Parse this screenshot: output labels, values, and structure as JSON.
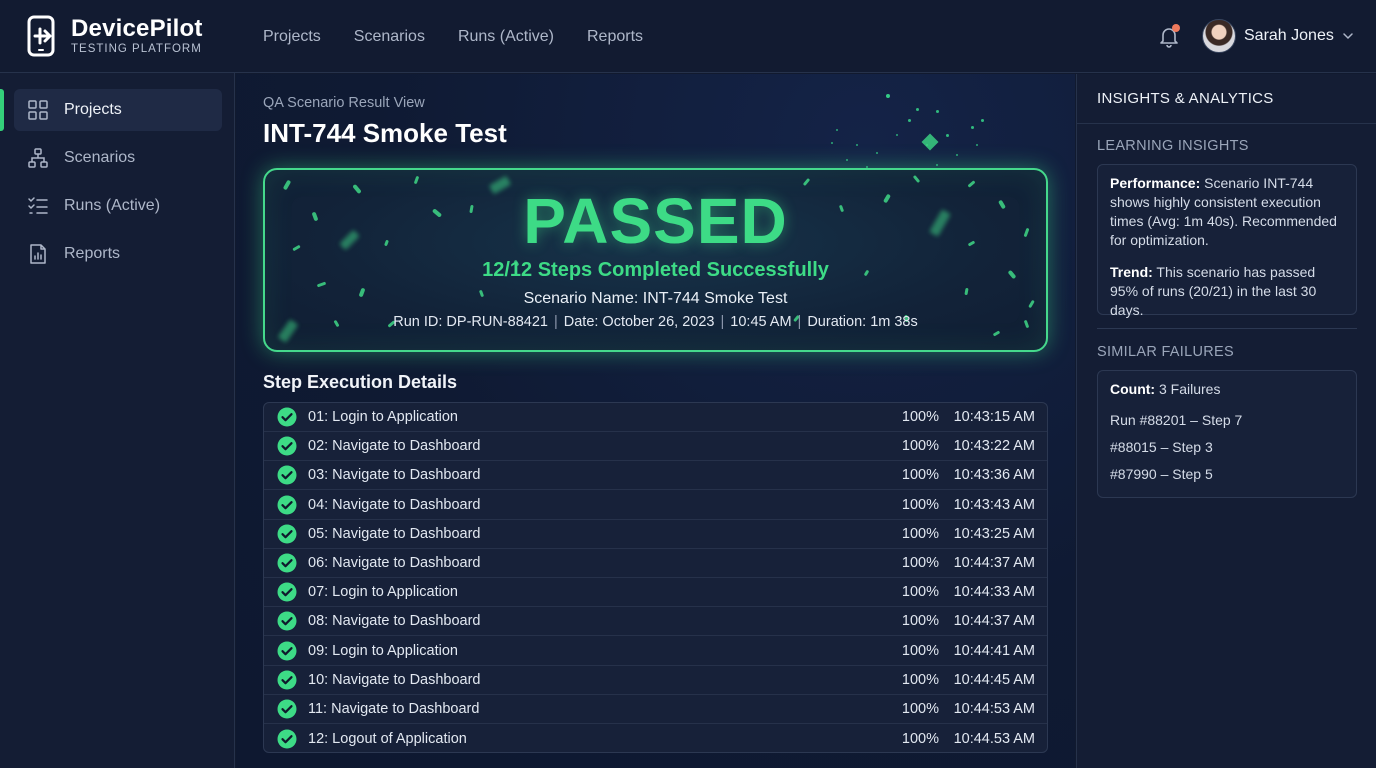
{
  "app": {
    "name": "DevicePilot",
    "subtitle": "TESTING PLATFORM"
  },
  "topnav": [
    "Projects",
    "Scenarios",
    "Runs (Active)",
    "Reports"
  ],
  "user": {
    "name": "Sarah Jones"
  },
  "sidebar": {
    "items": [
      {
        "label": "Projects",
        "icon": "grid-icon",
        "active": true
      },
      {
        "label": "Scenarios",
        "icon": "hierarchy-icon",
        "active": false
      },
      {
        "label": "Runs (Active)",
        "icon": "checklist-icon",
        "active": false
      },
      {
        "label": "Reports",
        "icon": "report-icon",
        "active": false
      }
    ]
  },
  "main": {
    "breadcrumb": "QA Scenario Result View",
    "title": "INT-744 Smoke Test",
    "banner": {
      "status": "PASSED",
      "steps_summary": "12/12 Steps Completed Successfully",
      "scenario": "Scenario Name: INT-744 Smoke Test",
      "run_id": "Run ID: DP-RUN-88421",
      "date": "Date: October 26, 2023",
      "time": "10:45 AM",
      "duration": "Duration: 1m 38s",
      "accent": "#3ddb86"
    },
    "steps_title": "Step Execution Details",
    "steps": [
      {
        "name": "01: Login to Application",
        "pct": "100%",
        "time": "10:43:15 AM"
      },
      {
        "name": "02: Navigate to Dashboard",
        "pct": "100%",
        "time": "10:43:22 AM"
      },
      {
        "name": "03: Navigate to Dashboard",
        "pct": "100%",
        "time": "10:43:36 AM"
      },
      {
        "name": "04: Navigate to Dashboard",
        "pct": "100%",
        "time": "10:43:43 AM"
      },
      {
        "name": "05: Navigate to Dashboard",
        "pct": "100%",
        "time": "10:43:25 AM"
      },
      {
        "name": "06: Navigate to Dashboard",
        "pct": "100%",
        "time": "10:44:37 AM"
      },
      {
        "name": "07: Login to Application",
        "pct": "100%",
        "time": "10:44:33 AM"
      },
      {
        "name": "08: Navigate to Dashboard",
        "pct": "100%",
        "time": "10:44:37 AM"
      },
      {
        "name": "09: Login to Application",
        "pct": "100%",
        "time": "10:44:41 AM"
      },
      {
        "name": "10: Navigate to Dashboard",
        "pct": "100%",
        "time": "10:44:45 AM"
      },
      {
        "name": "11: Navigate to Dashboard",
        "pct": "100%",
        "time": "10:44:53 AM"
      },
      {
        "name": "12: Logout of Application",
        "pct": "100%",
        "time": "10:44.53 AM"
      }
    ]
  },
  "insights": {
    "title": "INSIGHTS & ANALYTICS",
    "learning_title": "LEARNING INSIGHTS",
    "performance_label": "Performance:",
    "performance_text": "Scenario INT-744 shows highly consistent execution times (Avg: 1m 40s). Recommended for optimization.",
    "trend_label": "Trend:",
    "trend_text": "This scenario has passed 95% of runs (20/21) in the last 30 days.",
    "similar_title": "SIMILAR FAILURES",
    "count_label": "Count:",
    "count_value": "3 Failures",
    "failures": [
      "Run #88201 – Step 7",
      "#88015 – Step 3",
      "#87990 – Step 5"
    ]
  }
}
